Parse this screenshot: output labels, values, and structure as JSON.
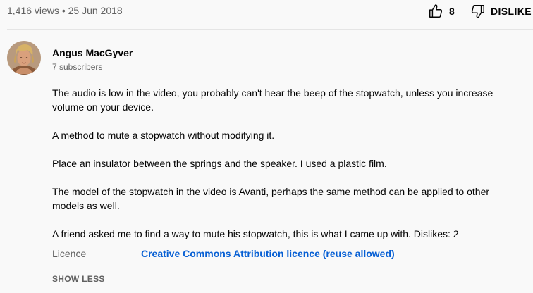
{
  "video": {
    "views_date": "1,416 views • 25 Jun 2018",
    "likes": "8",
    "dislike_label": "DISLIKE"
  },
  "channel": {
    "name": "Angus MacGyver",
    "subscribers": "7 subscribers",
    "avatar_icon": "person-photo"
  },
  "description": {
    "paragraphs": [
      "The audio is low in the video, you probably can't hear the beep of the stopwatch, unless you increase volume on your device.",
      "A method to mute a stopwatch without modifying it.",
      "Place an insulator between the springs and the speaker. I used a plastic film.",
      "The model of the stopwatch in the video is Avanti, perhaps the same method can be applied to other models as well.",
      "A friend asked me to find a way to mute his stopwatch, this is what I came up with. Dislikes: 2"
    ]
  },
  "licence": {
    "label": "Licence",
    "value": "Creative Commons Attribution licence (reuse allowed)"
  },
  "show_less_label": "SHOW LESS",
  "colors": {
    "background": "#f9f9f9",
    "link": "#065fd4",
    "secondary_text": "#606060"
  }
}
